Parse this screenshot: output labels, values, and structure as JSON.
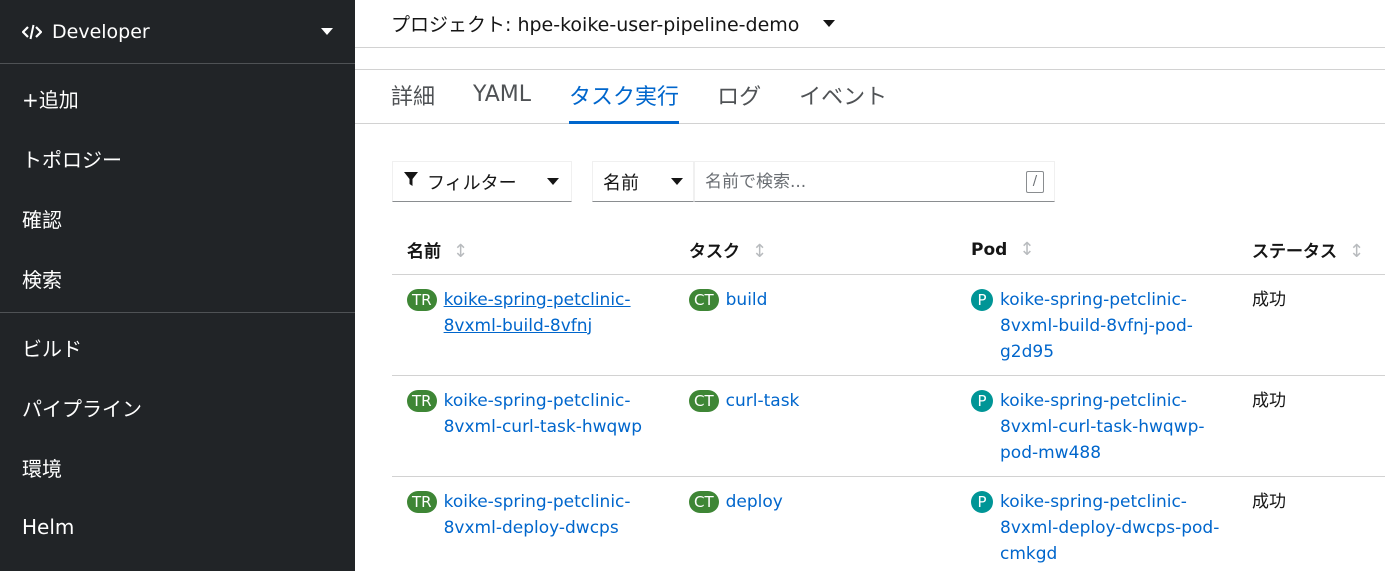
{
  "sidebar": {
    "perspective": "Developer",
    "group1": [
      "+追加",
      "トポロジー",
      "確認",
      "検索"
    ],
    "group2": [
      "ビルド",
      "パイプライン",
      "環境",
      "Helm"
    ]
  },
  "project": {
    "label": "プロジェクト: hpe-koike-user-pipeline-demo"
  },
  "tabs": [
    "詳細",
    "YAML",
    "タスク実行",
    "ログ",
    "イベント"
  ],
  "toolbar": {
    "filter_label": "フィルター",
    "name_select": "名前",
    "search_placeholder": "名前で検索...",
    "kbd_hint": "/"
  },
  "table": {
    "headers": [
      "名前",
      "タスク",
      "Pod",
      "ステータス"
    ],
    "rows": [
      {
        "tr_badge": "TR",
        "name_line1": "koike-spring-petclinic-",
        "name_line2": "8vxml-build-8vfnj",
        "ct_badge": "CT",
        "task": "build",
        "pod_badge": "P",
        "pod_line1": "koike-spring-petclinic-",
        "pod_line2": "8vxml-build-8vfnj-pod-",
        "pod_line3": "g2d95",
        "status": "成功"
      },
      {
        "tr_badge": "TR",
        "name_line1": "koike-spring-petclinic-",
        "name_line2": "8vxml-curl-task-hwqwp",
        "ct_badge": "CT",
        "task": "curl-task",
        "pod_badge": "P",
        "pod_line1": "koike-spring-petclinic-",
        "pod_line2": "8vxml-curl-task-hwqwp-",
        "pod_line3": "pod-mw488",
        "status": "成功"
      },
      {
        "tr_badge": "TR",
        "name_line1": "koike-spring-petclinic-",
        "name_line2": "8vxml-deploy-dwcps",
        "ct_badge": "CT",
        "task": "deploy",
        "pod_badge": "P",
        "pod_line1": "koike-spring-petclinic-",
        "pod_line2": "8vxml-deploy-dwcps-pod-",
        "pod_line3": "cmkgd",
        "status": "成功"
      }
    ]
  }
}
